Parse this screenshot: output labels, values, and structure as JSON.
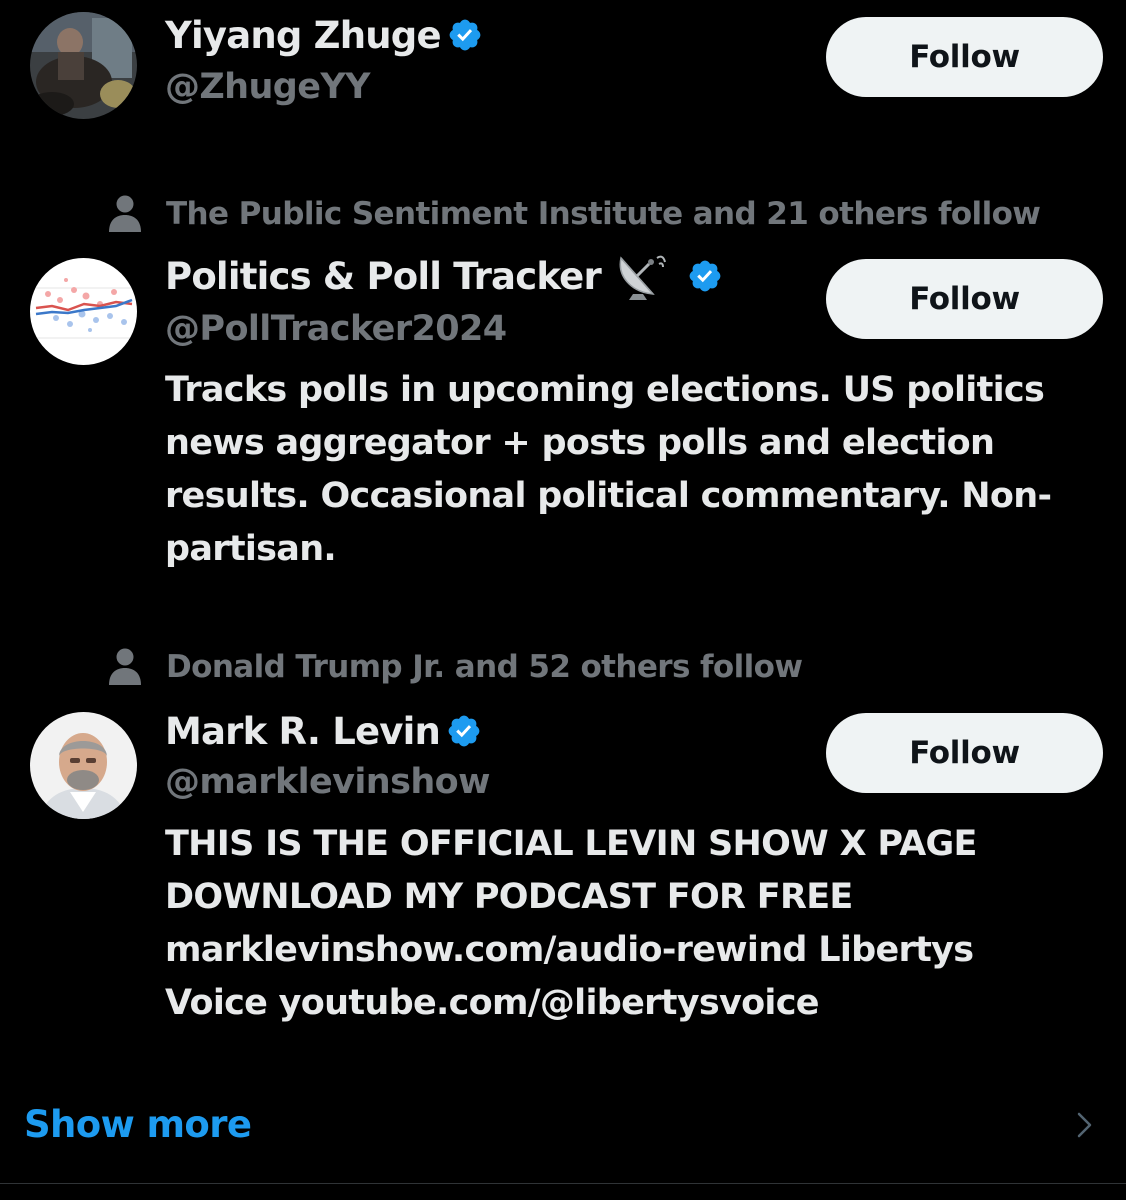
{
  "accounts": [
    {
      "display_name": "Yiyang Zhuge",
      "handle": "@ZhugeYY",
      "verified": true,
      "follow_label": "Follow"
    },
    {
      "social_context": "The Public Sentiment Institute and 21 others follow",
      "display_name": "Politics & Poll Tracker",
      "name_emoji": "satellite-antenna-icon",
      "handle": "@PollTracker2024",
      "verified": true,
      "follow_label": "Follow",
      "bio_lines": [
        "Tracks polls in upcoming elections. US politics",
        "news aggregator + posts polls and election",
        "results. Occasional political commentary. Non-",
        "partisan."
      ]
    },
    {
      "social_context": "Donald Trump Jr. and 52 others follow",
      "display_name": "Mark R. Levin",
      "handle": "@marklevinshow",
      "verified": true,
      "follow_label": "Follow",
      "bio_lines": [
        "THIS IS THE OFFICIAL LEVIN SHOW X PAGE",
        "DOWNLOAD MY PODCAST FOR FREE",
        "marklevinshow.com/audio-rewind Libertys",
        "Voice youtube.com/@libertysvoice"
      ]
    }
  ],
  "show_more_label": "Show more",
  "colors": {
    "background": "#000000",
    "primary_text": "#e7e9ea",
    "secondary_text": "#71767b",
    "accent": "#1d9bf0",
    "button_bg": "#eff3f4",
    "button_text": "#0f1419"
  }
}
